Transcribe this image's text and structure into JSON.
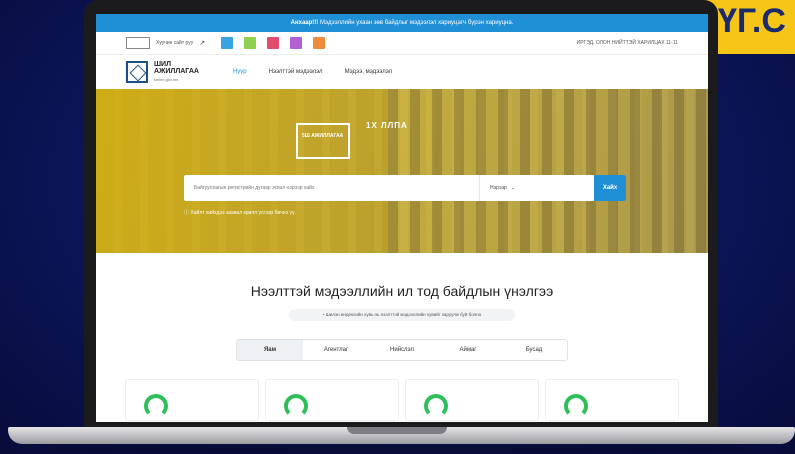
{
  "announcement": {
    "bold": "Анхаар!!!",
    "text": " Мэдээллийн ухаан зөв байдлыг мэдээлэл хариуцагч бүрэн хариуцна."
  },
  "badge_text": "ҮГ.С",
  "util": {
    "link": "Хуучин сайт руу",
    "right": "ИРГЭД, ОЛОН НИЙТТЭЙ ХАРИЛЦАХ 11-11",
    "tiles": [
      "#37a3e0",
      "#8fd14f",
      "#e24b6b",
      "#b55fd6",
      "#f08a3c"
    ]
  },
  "nav": {
    "logo_title_1": "ШИЛ",
    "logo_title_2": "АЖИЛЛАГАА",
    "logo_sub": "shilen.gov.mn",
    "links": [
      "Нүүр",
      "Нээлттэй мэдээлэл",
      "Мэдээ, мэдээлэл"
    ]
  },
  "hero": {
    "logo_text": "5Ш АЖИЛЛАГАА",
    "years": "1Х ЛЛПА",
    "search_placeholder": "Байгууллагын регистрийн дугаар эсвэл нэрээр хайх",
    "select_value": "Нэрээр",
    "search_button": "Хайх",
    "hint": "Хайлт хийхдээ заавал крилл үсгээр бичнэ үү."
  },
  "section": {
    "title": "Нээлттэй мэдээллийн ил тод байдлын үнэлгээ",
    "pill": "Шилэн индексийн хувь нь нээлттэй мэдээллийн хувийг харуулж буй болно",
    "tabs": [
      "Яам",
      "Агентлаг",
      "Нийслэл",
      "Аймаг",
      "Бусад"
    ]
  },
  "colors": {
    "accent": "#1f8fd6",
    "hero": "#d4b21a",
    "ring": "#2fbf5a"
  }
}
